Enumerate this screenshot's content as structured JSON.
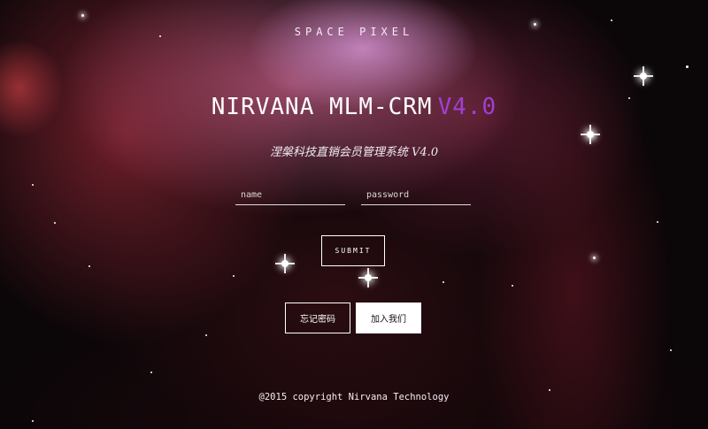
{
  "header": {
    "brand": "SPACE PIXEL"
  },
  "hero": {
    "title": "NIRVANA MLM-CRM",
    "version": "V4.0",
    "version_color": "#a13fd3",
    "subtitle": "涅槃科技直销会员管理系统 V4.0"
  },
  "login_form": {
    "name_placeholder": "name",
    "password_placeholder": "password",
    "submit_label": "SUBMIT"
  },
  "actions": {
    "forgot_password_label": "忘记密码",
    "join_us_label": "加入我们"
  },
  "footer": {
    "copyright": "@2015 copyright Nirvana Technology"
  },
  "background": {
    "description_icon": "nebula-starfield-background",
    "base_color": "#0b0608"
  }
}
